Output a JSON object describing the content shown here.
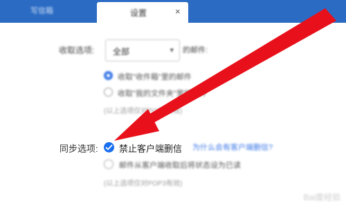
{
  "tabs": {
    "inactive_label": "写信箱",
    "active_label": "设置"
  },
  "settings": {
    "receive_label": "收取选项:",
    "receive_select_value": "全部",
    "receive_suffix": "的邮件:",
    "radio_1_label": "收取\"收件箱\"里的邮件",
    "radio_2_label": "收取\"我的文件夹\"里的邮件",
    "radio_hint": "(以上选项仅对POP3有效)",
    "sync_label": "同步选项:",
    "check_1_label": "禁止客户端删信",
    "check_1_help": "为什么会有客户端删信?",
    "check_2_label": "邮件从客户端收取后将状态设为已读",
    "check_2_hint": "(以上选项仅对POP3有效)"
  },
  "watermark": "Bai度经验"
}
